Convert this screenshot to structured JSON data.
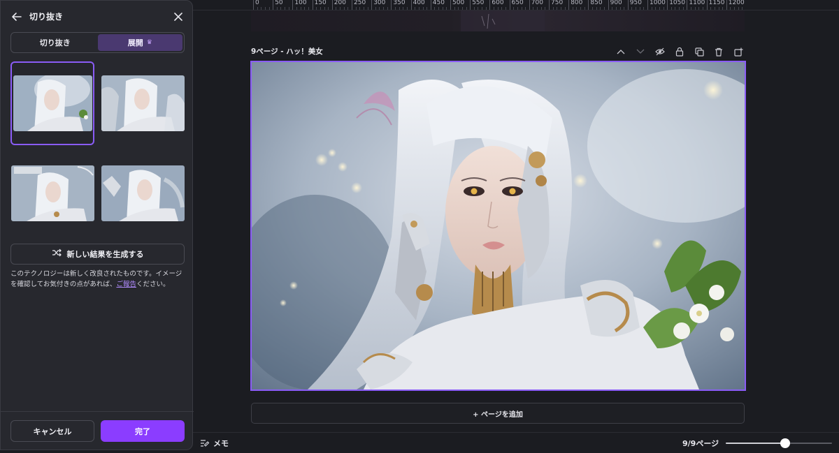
{
  "panel": {
    "title": "切り抜き",
    "tabs": [
      {
        "label": "切り抜き",
        "active": false
      },
      {
        "label": "展開",
        "active": true,
        "icon": "crown-icon"
      }
    ],
    "generate_label": "新しい結果を生成する",
    "note_text": "このテクノロジーは新しく改良されたものです。イメージを確認してお気付きの点があれば、",
    "note_link": "ご報告",
    "note_tail": "ください。",
    "cancel_label": "キャンセル",
    "done_label": "完了"
  },
  "ruler": {
    "labels": [
      "0",
      "50",
      "100",
      "150",
      "200",
      "250",
      "300",
      "350",
      "400",
      "450",
      "500",
      "550",
      "600",
      "650",
      "700",
      "750",
      "800",
      "850",
      "900",
      "950",
      "1000",
      "1050",
      "1100",
      "1150",
      "1200"
    ]
  },
  "page": {
    "title": "9ページ - ハッ！美女",
    "add_page_label": "+ ページを追加"
  },
  "bottom": {
    "memo_label": "メモ",
    "page_count": "9/9ページ",
    "zoom_level": 0.56
  },
  "colors": {
    "accent": "#8b3dff",
    "selection": "#8a5cf6",
    "background": "#1b1c21",
    "panel": "#27282e"
  }
}
